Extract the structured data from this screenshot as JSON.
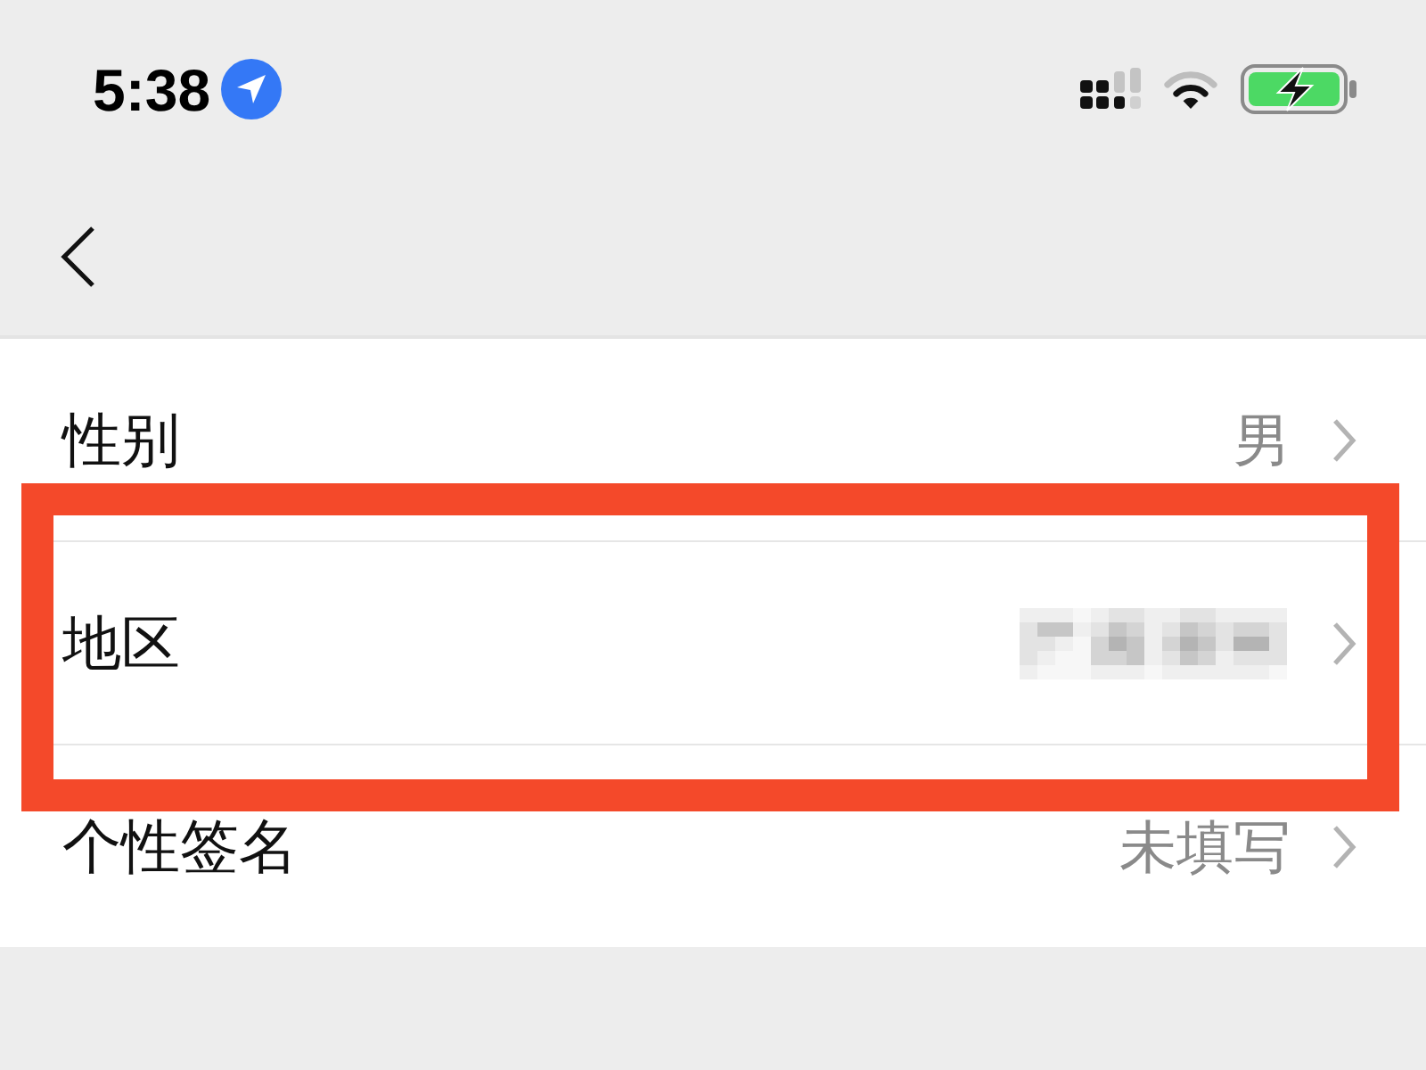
{
  "status_bar": {
    "time": "5:38"
  },
  "rows": [
    {
      "label": "性别",
      "value": "男",
      "redacted": false,
      "highlighted": false
    },
    {
      "label": "地区",
      "redacted": true,
      "highlighted": true
    },
    {
      "label": "个性签名",
      "value": "未填写",
      "redacted": false,
      "highlighted": false
    }
  ]
}
